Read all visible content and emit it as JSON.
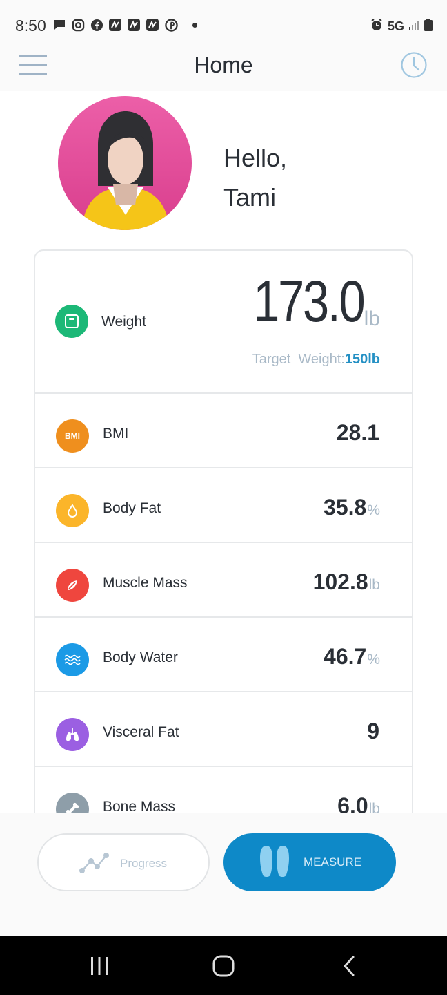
{
  "status_bar": {
    "time": "8:50",
    "network": "5G",
    "notification_icons": [
      "message-icon",
      "instagram-icon",
      "facebook-icon",
      "app-n-icon",
      "app-n-icon",
      "app-n-icon",
      "pinterest-icon"
    ]
  },
  "header": {
    "title": "Home",
    "menu_icon": "hamburger-menu-icon",
    "history_icon": "clock-icon"
  },
  "profile": {
    "greeting_line1": "Hello,",
    "greeting_line2": "Tami"
  },
  "weight": {
    "label": "Weight",
    "value": "173.0",
    "unit": "lb",
    "target_label": "Target  Weight:",
    "target_value": "150lb",
    "icon": "scale-icon",
    "color": "#1cb877"
  },
  "metrics": [
    {
      "label": "BMI",
      "value": "28.1",
      "unit": "",
      "icon": "bmi-icon",
      "icon_text": "BMI",
      "color": "#ef8f1e"
    },
    {
      "label": "Body Fat",
      "value": "35.8",
      "unit": "%",
      "icon": "drop-icon",
      "color": "#fbb52a"
    },
    {
      "label": "Muscle Mass",
      "value": "102.8",
      "unit": "lb",
      "icon": "muscle-icon",
      "color": "#ef463e"
    },
    {
      "label": "Body Water",
      "value": "46.7",
      "unit": "%",
      "icon": "water-waves-icon",
      "color": "#1b9ae6"
    },
    {
      "label": "Visceral Fat",
      "value": "9",
      "unit": "",
      "icon": "lungs-icon",
      "color": "#9b5fe2"
    },
    {
      "label": "Bone Mass",
      "value": "6.0",
      "unit": "lb",
      "icon": "bone-icon",
      "color": "#8e9ea9"
    }
  ],
  "buttons": {
    "progress_label": "Progress",
    "measure_label": "MEASURE"
  },
  "colors": {
    "accent": "#0e89c8",
    "target_value": "#2490c4",
    "unit_gray": "#a9b9c7"
  }
}
